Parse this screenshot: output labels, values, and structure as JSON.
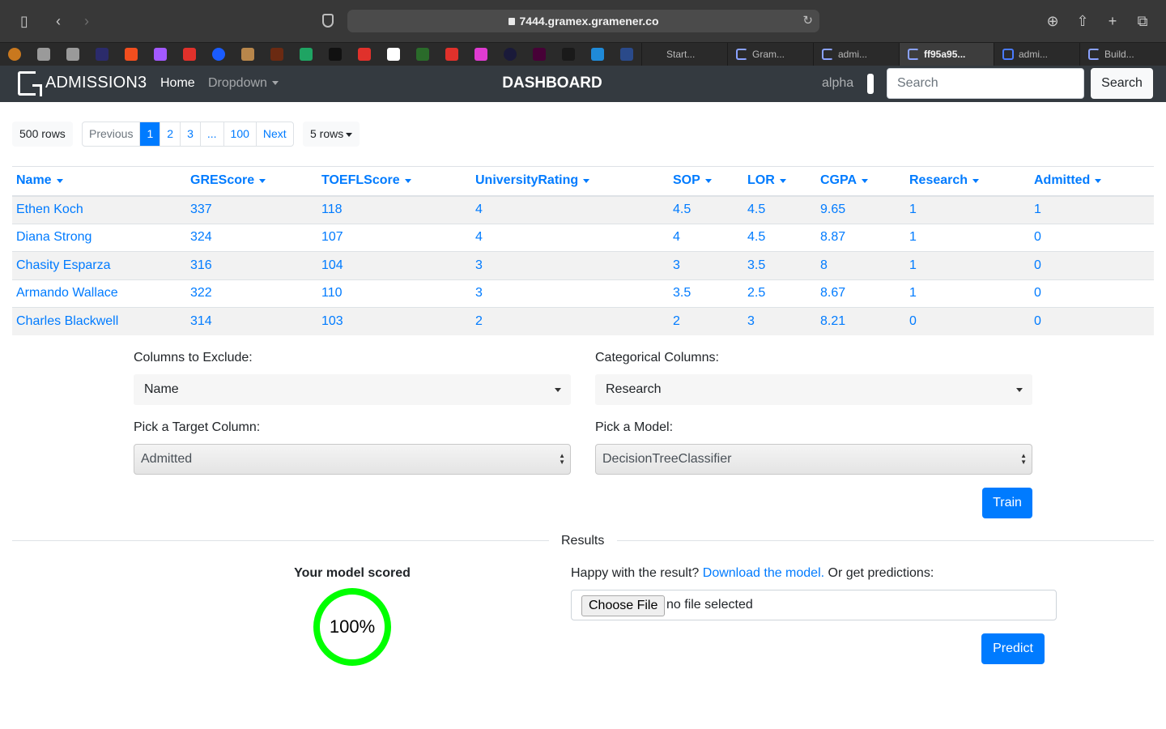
{
  "browser": {
    "url": "7444.gramex.gramener.co",
    "tabs": [
      {
        "label": "Start..."
      },
      {
        "label": "Gram..."
      },
      {
        "label": "admi..."
      },
      {
        "label": "ff95a95..."
      },
      {
        "label": "admi..."
      },
      {
        "label": "Build..."
      }
    ]
  },
  "navbar": {
    "brand": "ADMISSION3",
    "home": "Home",
    "dropdown": "Dropdown",
    "title": "DASHBOARD",
    "user": "alpha",
    "search_placeholder": "Search",
    "search_button": "Search"
  },
  "toolbar": {
    "row_count": "500 rows",
    "pager": [
      "Previous",
      "1",
      "2",
      "3",
      "...",
      "100",
      "Next"
    ],
    "rows_per_page": "5 rows"
  },
  "table": {
    "columns": [
      "Name",
      "GREScore",
      "TOEFLScore",
      "UniversityRating",
      "SOP",
      "LOR",
      "CGPA",
      "Research",
      "Admitted"
    ],
    "rows": [
      [
        "Ethen Koch",
        "337",
        "118",
        "4",
        "4.5",
        "4.5",
        "9.65",
        "1",
        "1"
      ],
      [
        "Diana Strong",
        "324",
        "107",
        "4",
        "4",
        "4.5",
        "8.87",
        "1",
        "0"
      ],
      [
        "Chasity Esparza",
        "316",
        "104",
        "3",
        "3",
        "3.5",
        "8",
        "1",
        "0"
      ],
      [
        "Armando Wallace",
        "322",
        "110",
        "3",
        "3.5",
        "2.5",
        "8.67",
        "1",
        "0"
      ],
      [
        "Charles Blackwell",
        "314",
        "103",
        "2",
        "2",
        "3",
        "8.21",
        "0",
        "0"
      ]
    ]
  },
  "form": {
    "exclude_label": "Columns to Exclude:",
    "exclude_value": "Name",
    "categorical_label": "Categorical Columns:",
    "categorical_value": "Research",
    "target_label": "Pick a Target Column:",
    "target_value": "Admitted",
    "model_label": "Pick a Model:",
    "model_value": "DecisionTreeClassifier",
    "train_button": "Train"
  },
  "results": {
    "title": "Results",
    "score_label": "Your model scored",
    "score_value": "100%",
    "happy_text": "Happy with the result?",
    "download_link": "Download the model.",
    "predictions_text": "Or get predictions:",
    "choose_file": "Choose File",
    "no_file": "no file selected",
    "predict_button": "Predict"
  },
  "colors": {
    "primary": "#007bff",
    "navbar": "#343a40",
    "score_ring": "#00ff00"
  }
}
